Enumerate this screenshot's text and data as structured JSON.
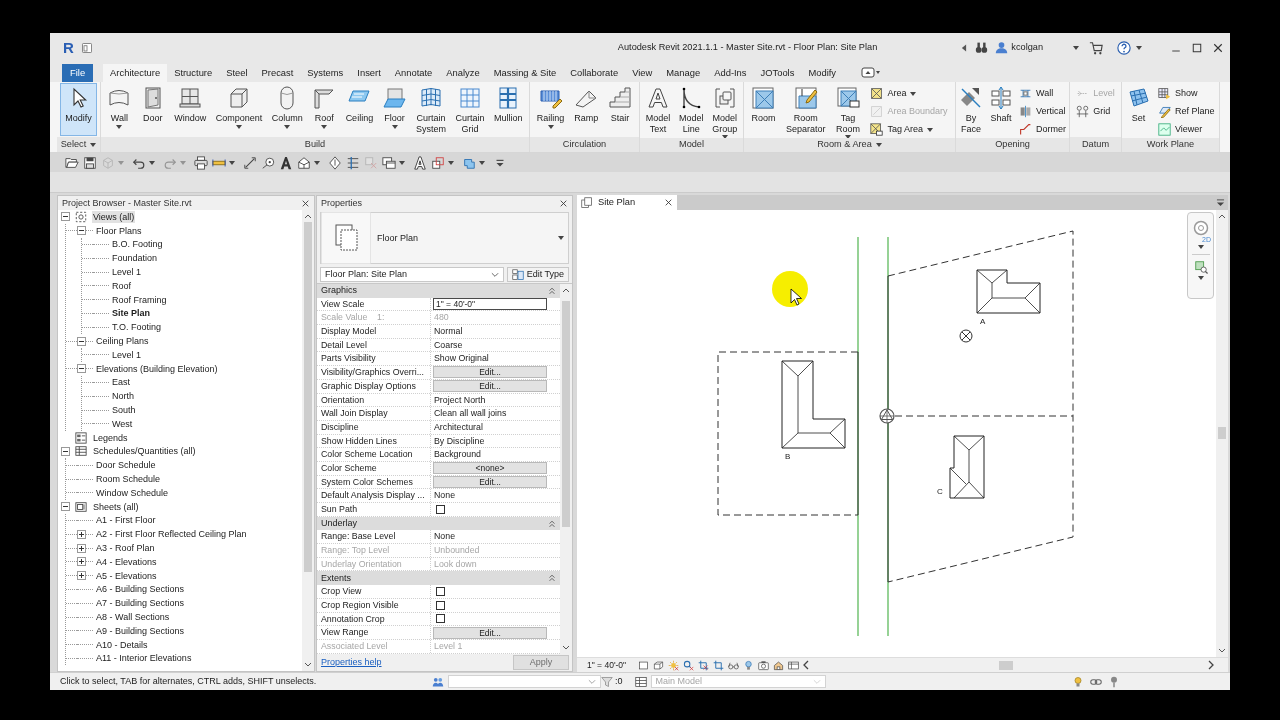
{
  "window": {
    "logo": "R",
    "title": "Autodesk Revit 2021.1.1 - Master Site.rvt - Floor Plan: Site Plan",
    "user": "kcolgan"
  },
  "ribbon_tabs": [
    {
      "label": "File",
      "kind": "file",
      "selected": false
    },
    {
      "label": "Architecture",
      "kind": "tab",
      "selected": true
    },
    {
      "label": "Structure",
      "kind": "tab",
      "selected": false
    },
    {
      "label": "Steel",
      "kind": "tab",
      "selected": false
    },
    {
      "label": "Precast",
      "kind": "tab",
      "selected": false
    },
    {
      "label": "Systems",
      "kind": "tab",
      "selected": false
    },
    {
      "label": "Insert",
      "kind": "tab",
      "selected": false
    },
    {
      "label": "Annotate",
      "kind": "tab",
      "selected": false
    },
    {
      "label": "Analyze",
      "kind": "tab",
      "selected": false
    },
    {
      "label": "Massing & Site",
      "kind": "tab",
      "selected": false
    },
    {
      "label": "Collaborate",
      "kind": "tab",
      "selected": false
    },
    {
      "label": "View",
      "kind": "tab",
      "selected": false
    },
    {
      "label": "Manage",
      "kind": "tab",
      "selected": false
    },
    {
      "label": "Add-Ins",
      "kind": "tab",
      "selected": false
    },
    {
      "label": "JOTools",
      "kind": "tab",
      "selected": false
    },
    {
      "label": "Modify",
      "kind": "tab",
      "selected": false
    }
  ],
  "ribbon_panels": [
    {
      "title": "Select",
      "menu": true,
      "tools": [
        {
          "label": "Modify",
          "kind": "large",
          "caret": false,
          "active": true,
          "disabled": false
        }
      ]
    },
    {
      "title": "Build",
      "menu": false,
      "tools": [
        {
          "label": "Wall",
          "kind": "large",
          "caret": true,
          "active": false,
          "disabled": false
        },
        {
          "label": "Door",
          "kind": "large",
          "caret": false,
          "active": false,
          "disabled": false
        },
        {
          "label": "Window",
          "kind": "large",
          "caret": false,
          "active": false,
          "disabled": false
        },
        {
          "label": "Component",
          "kind": "large",
          "caret": true,
          "active": false,
          "disabled": false
        },
        {
          "label": "Column",
          "kind": "large",
          "caret": true,
          "active": false,
          "disabled": false
        },
        {
          "label": "Roof",
          "kind": "large",
          "caret": true,
          "active": false,
          "disabled": false
        },
        {
          "label": "Ceiling",
          "kind": "large",
          "caret": false,
          "active": false,
          "disabled": false
        },
        {
          "label": "Floor",
          "kind": "large",
          "caret": true,
          "active": false,
          "disabled": false
        },
        {
          "label": "Curtain System",
          "kind": "large",
          "caret": false,
          "active": false,
          "disabled": false
        },
        {
          "label": "Curtain Grid",
          "kind": "large",
          "caret": false,
          "active": false,
          "disabled": false
        },
        {
          "label": "Mullion",
          "kind": "large",
          "caret": false,
          "active": false,
          "disabled": false
        }
      ]
    },
    {
      "title": "Circulation",
      "menu": false,
      "tools": [
        {
          "label": "Railing",
          "kind": "large",
          "caret": true,
          "active": false,
          "disabled": false
        },
        {
          "label": "Ramp",
          "kind": "large",
          "caret": false,
          "active": false,
          "disabled": false
        },
        {
          "label": "Stair",
          "kind": "large",
          "caret": false,
          "active": false,
          "disabled": false
        }
      ]
    },
    {
      "title": "Model",
      "menu": false,
      "tools": [
        {
          "label": "Model Text",
          "kind": "large",
          "caret": false,
          "active": false,
          "disabled": false
        },
        {
          "label": "Model Line",
          "kind": "large",
          "caret": false,
          "active": false,
          "disabled": false
        },
        {
          "label": "Model Group",
          "kind": "large",
          "caret": true,
          "active": false,
          "disabled": false
        }
      ]
    },
    {
      "title": "Room & Area",
      "menu": true,
      "tools": [
        {
          "label": "Room",
          "kind": "large",
          "caret": false,
          "active": false,
          "disabled": false
        },
        {
          "label": "Room Separator",
          "kind": "large",
          "caret": false,
          "active": false,
          "disabled": false
        },
        {
          "label": "Tag Room",
          "kind": "large",
          "caret": true,
          "active": false,
          "disabled": false
        },
        {
          "label": "Area",
          "kind": "small",
          "caret": true,
          "active": false,
          "disabled": false
        },
        {
          "label": "Area Boundary",
          "kind": "small",
          "caret": false,
          "active": false,
          "disabled": true
        },
        {
          "label": "Tag Area",
          "kind": "small",
          "caret": true,
          "active": false,
          "disabled": false
        }
      ]
    },
    {
      "title": "Opening",
      "menu": false,
      "tools": [
        {
          "label": "By Face",
          "kind": "large",
          "caret": false,
          "active": false,
          "disabled": false
        },
        {
          "label": "Shaft",
          "kind": "large",
          "caret": false,
          "active": false,
          "disabled": false
        },
        {
          "label": "Wall",
          "kind": "small",
          "caret": false,
          "active": false,
          "disabled": false
        },
        {
          "label": "Vertical",
          "kind": "small",
          "caret": false,
          "active": false,
          "disabled": false
        },
        {
          "label": "Dormer",
          "kind": "small",
          "caret": false,
          "active": false,
          "disabled": false
        }
      ]
    },
    {
      "title": "Datum",
      "menu": false,
      "tools": [
        {
          "label": "Level",
          "kind": "small",
          "caret": false,
          "active": false,
          "disabled": true
        },
        {
          "label": "Grid",
          "kind": "small",
          "caret": false,
          "active": false,
          "disabled": false
        }
      ]
    },
    {
      "title": "Work Plane",
      "menu": false,
      "tools": [
        {
          "label": "Set",
          "kind": "large",
          "caret": false,
          "active": false,
          "disabled": false
        },
        {
          "label": "Show",
          "kind": "small",
          "caret": false,
          "active": false,
          "disabled": false
        },
        {
          "label": "Ref Plane",
          "kind": "small",
          "caret": false,
          "active": false,
          "disabled": false
        },
        {
          "label": "Viewer",
          "kind": "small",
          "caret": false,
          "active": false,
          "disabled": false
        }
      ]
    }
  ],
  "quick_access": [
    {
      "disabled": false,
      "caret": false
    },
    {
      "disabled": false,
      "caret": false
    },
    {
      "disabled": true,
      "caret": true
    },
    {
      "disabled": false,
      "caret": true
    },
    {
      "disabled": true,
      "caret": true
    },
    {
      "disabled": false,
      "caret": false
    },
    {
      "disabled": false,
      "caret": true
    },
    {
      "disabled": false,
      "caret": false
    },
    {
      "disabled": false,
      "caret": false
    },
    {
      "disabled": false,
      "caret": false
    },
    {
      "disabled": false,
      "caret": true
    },
    {
      "disabled": false,
      "caret": false
    },
    {
      "disabled": false,
      "caret": false
    },
    {
      "disabled": true,
      "caret": false
    },
    {
      "disabled": false,
      "caret": true
    },
    {
      "disabled": false,
      "caret": false
    },
    {
      "disabled": false,
      "caret": true
    },
    {
      "disabled": false,
      "caret": true
    },
    {
      "disabled": false,
      "caret": false
    }
  ],
  "project_browser": {
    "title": "Project Browser - Master Site.rvt",
    "tree": [
      {
        "label": "Views (all)",
        "kind": "views",
        "expanded": true,
        "selected": true,
        "current": false,
        "children": [
          {
            "label": "Floor Plans",
            "expanded": true,
            "selected": false,
            "current": false,
            "children": [
              {
                "label": "B.O. Footing",
                "selected": false,
                "current": false
              },
              {
                "label": "Foundation",
                "selected": false,
                "current": false
              },
              {
                "label": "Level 1",
                "selected": false,
                "current": false
              },
              {
                "label": "Roof",
                "selected": false,
                "current": false
              },
              {
                "label": "Roof Framing",
                "selected": false,
                "current": false
              },
              {
                "label": "Site Plan",
                "selected": false,
                "current": true
              },
              {
                "label": "T.O. Footing",
                "selected": false,
                "current": false
              }
            ]
          },
          {
            "label": "Ceiling Plans",
            "expanded": true,
            "selected": false,
            "current": false,
            "children": [
              {
                "label": "Level 1",
                "selected": false,
                "current": false
              }
            ]
          },
          {
            "label": "Elevations (Building Elevation)",
            "expanded": true,
            "selected": false,
            "current": false,
            "children": [
              {
                "label": "East",
                "selected": false,
                "current": false
              },
              {
                "label": "North",
                "selected": false,
                "current": false
              },
              {
                "label": "South",
                "selected": false,
                "current": false
              },
              {
                "label": "West",
                "selected": false,
                "current": false
              }
            ]
          }
        ]
      },
      {
        "label": "Legends",
        "kind": "legends",
        "selected": false,
        "current": false
      },
      {
        "label": "Schedules/Quantities (all)",
        "kind": "schedules",
        "expanded": true,
        "selected": false,
        "current": false,
        "children": [
          {
            "label": "Door Schedule",
            "selected": false,
            "current": false
          },
          {
            "label": "Room Schedule",
            "selected": false,
            "current": false
          },
          {
            "label": "Window Schedule",
            "selected": false,
            "current": false
          }
        ]
      },
      {
        "label": "Sheets (all)",
        "kind": "sheets",
        "expanded": true,
        "selected": false,
        "current": false,
        "children": [
          {
            "label": "A1 - First Floor",
            "selected": false,
            "current": false
          },
          {
            "label": "A2 - First Floor Reflected Ceiling Plan",
            "expanded": false,
            "selected": false,
            "current": false
          },
          {
            "label": "A3 - Roof Plan",
            "expanded": false,
            "selected": false,
            "current": false
          },
          {
            "label": "A4 - Elevations",
            "expanded": false,
            "selected": false,
            "current": false
          },
          {
            "label": "A5 - Elevations",
            "expanded": false,
            "selected": false,
            "current": false
          },
          {
            "label": "A6 - Building Sections",
            "selected": false,
            "current": false
          },
          {
            "label": "A7 - Building Sections",
            "selected": false,
            "current": false
          },
          {
            "label": "A8 - Wall Sections",
            "selected": false,
            "current": false
          },
          {
            "label": "A9 - Building Sections",
            "selected": false,
            "current": false
          },
          {
            "label": "A10 - Details",
            "selected": false,
            "current": false
          },
          {
            "label": "A11 - Interior Elevations",
            "selected": false,
            "current": false
          }
        ]
      }
    ]
  },
  "properties": {
    "title": "Properties",
    "type_name": "Floor Plan",
    "instance": "Floor Plan: Site Plan",
    "edit_type": "Edit Type",
    "groups": [
      {
        "name": "Graphics",
        "expanded": true,
        "rows": [
          {
            "name": "View Scale",
            "kind": "input",
            "value": "1\" = 40'-0\"",
            "disabled": false
          },
          {
            "name": "Scale Value    1:",
            "kind": "text",
            "value": "480",
            "disabled": true
          },
          {
            "name": "Display Model",
            "kind": "text",
            "value": "Normal",
            "disabled": false
          },
          {
            "name": "Detail Level",
            "kind": "text",
            "value": "Coarse",
            "disabled": false
          },
          {
            "name": "Parts Visibility",
            "kind": "text",
            "value": "Show Original",
            "disabled": false
          },
          {
            "name": "Visibility/Graphics Overri...",
            "kind": "button",
            "value": "Edit...",
            "disabled": false
          },
          {
            "name": "Graphic Display Options",
            "kind": "button",
            "value": "Edit...",
            "disabled": false
          },
          {
            "name": "Orientation",
            "kind": "text",
            "value": "Project North",
            "disabled": false
          },
          {
            "name": "Wall Join Display",
            "kind": "text",
            "value": "Clean all wall joins",
            "disabled": false
          },
          {
            "name": "Discipline",
            "kind": "text",
            "value": "Architectural",
            "disabled": false
          },
          {
            "name": "Show Hidden Lines",
            "kind": "text",
            "value": "By Discipline",
            "disabled": false
          },
          {
            "name": "Color Scheme Location",
            "kind": "text",
            "value": "Background",
            "disabled": false
          },
          {
            "name": "Color Scheme",
            "kind": "button",
            "value": "<none>",
            "disabled": false
          },
          {
            "name": "System Color Schemes",
            "kind": "button",
            "value": "Edit...",
            "disabled": false
          },
          {
            "name": "Default Analysis Display ...",
            "kind": "text",
            "value": "None",
            "disabled": false
          },
          {
            "name": "Sun Path",
            "kind": "checkbox",
            "checked": false,
            "disabled": false
          }
        ]
      },
      {
        "name": "Underlay",
        "expanded": true,
        "rows": [
          {
            "name": "Range: Base Level",
            "kind": "text",
            "value": "None",
            "disabled": false
          },
          {
            "name": "Range: Top Level",
            "kind": "text",
            "value": "Unbounded",
            "disabled": true
          },
          {
            "name": "Underlay Orientation",
            "kind": "text",
            "value": "Look down",
            "disabled": true
          }
        ]
      },
      {
        "name": "Extents",
        "expanded": true,
        "rows": [
          {
            "name": "Crop View",
            "kind": "checkbox",
            "checked": false,
            "disabled": false
          },
          {
            "name": "Crop Region Visible",
            "kind": "checkbox",
            "checked": false,
            "disabled": false
          },
          {
            "name": "Annotation Crop",
            "kind": "checkbox",
            "checked": false,
            "disabled": false
          },
          {
            "name": "View Range",
            "kind": "button",
            "value": "Edit...",
            "disabled": false
          },
          {
            "name": "Associated Level",
            "kind": "text",
            "value": "Level 1",
            "disabled": true
          }
        ]
      }
    ],
    "help": "Properties help",
    "apply": {
      "label": "Apply",
      "disabled": true
    }
  },
  "view": {
    "tab": "Site Plan",
    "navigation_wheel": "2D",
    "buildings": [
      {
        "label": "A"
      },
      {
        "label": "B"
      },
      {
        "label": "C"
      }
    ],
    "scale": "1\" = 40'-0\""
  },
  "status_bar": {
    "message": "Click to select, TAB for alternates, CTRL adds, SHIFT unselects.",
    "selection_count": ":0",
    "model": {
      "label": "Main Model",
      "disabled": true
    }
  }
}
